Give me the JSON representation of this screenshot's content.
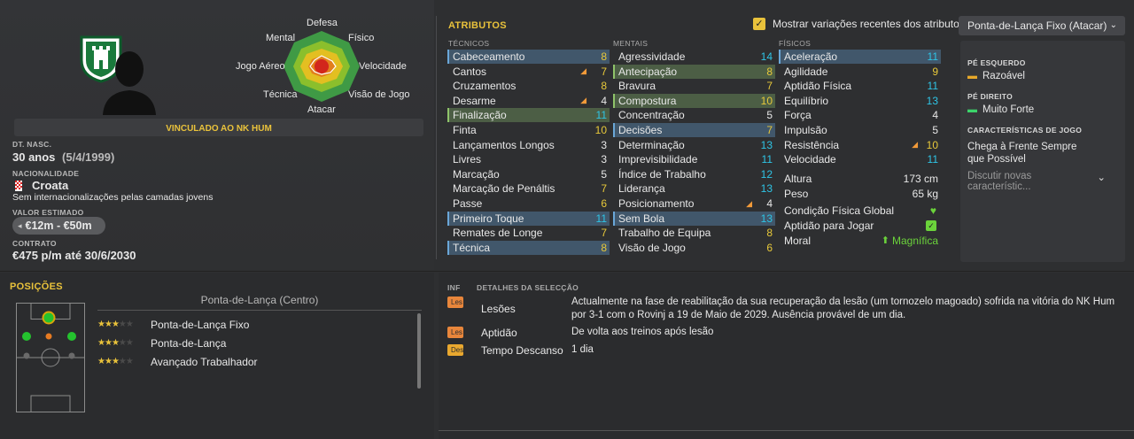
{
  "club_badge": "nk-hum-crest",
  "contract_banner": "VINCULADO AO NK HUM",
  "radar": {
    "labels": {
      "top": "Defesa",
      "tr": "Físico",
      "r": "Velocidade",
      "br": "Visão de Jogo",
      "bottom": "Atacar",
      "bl": "Técnica",
      "l": "Jogo Aéreo",
      "tl": "Mental"
    }
  },
  "bio": {
    "dob_label": "DT. NASC.",
    "age": "30 anos",
    "dob": "(5/4/1999)",
    "nat_label": "NACIONALIDADE",
    "nation": "Croata",
    "intl": "Sem internacionalizações pelas camadas jovens",
    "value_label": "VALOR ESTIMADO",
    "value": "€12m - €50m",
    "contract_label": "CONTRATO",
    "contract": "€475 p/m até 30/6/2030"
  },
  "attrs": {
    "title": "ATRIBUTOS",
    "toggle_label": "Mostrar variações recentes dos atributos",
    "role_select": "Ponta-de-Lança Fixo (Atacar)",
    "tech_header": "TÉCNICOS",
    "mental_header": "MENTAIS",
    "phys_header": "FÍSICOS",
    "technical": [
      {
        "n": "Cabeceamento",
        "v": "8",
        "hl": "blue",
        "c": "c-yel"
      },
      {
        "n": "Cantos",
        "v": "7",
        "up": true,
        "c": "c-yel"
      },
      {
        "n": "Cruzamentos",
        "v": "8",
        "c": "c-yel"
      },
      {
        "n": "Desarme",
        "v": "4",
        "up": true,
        "c": "c-white"
      },
      {
        "n": "Finalização",
        "v": "11",
        "hl": "green",
        "c": "c-cyan"
      },
      {
        "n": "Finta",
        "v": "10",
        "c": "c-yel"
      },
      {
        "n": "Lançamentos Longos",
        "v": "3",
        "c": "c-white"
      },
      {
        "n": "Livres",
        "v": "3",
        "c": "c-white"
      },
      {
        "n": "Marcação",
        "v": "5",
        "c": "c-white"
      },
      {
        "n": "Marcação de Penáltis",
        "v": "7",
        "c": "c-yel"
      },
      {
        "n": "Passe",
        "v": "6",
        "c": "c-yel"
      },
      {
        "n": "Primeiro Toque",
        "v": "11",
        "hl": "blue",
        "c": "c-cyan"
      },
      {
        "n": "Remates de Longe",
        "v": "7",
        "c": "c-yel"
      },
      {
        "n": "Técnica",
        "v": "8",
        "hl": "blue",
        "c": "c-yel"
      }
    ],
    "mental": [
      {
        "n": "Agressividade",
        "v": "14",
        "c": "c-cyan"
      },
      {
        "n": "Antecipação",
        "v": "8",
        "hl": "green",
        "c": "c-yel"
      },
      {
        "n": "Bravura",
        "v": "7",
        "c": "c-yel"
      },
      {
        "n": "Compostura",
        "v": "10",
        "hl": "green",
        "c": "c-yel"
      },
      {
        "n": "Concentração",
        "v": "5",
        "c": "c-white"
      },
      {
        "n": "Decisões",
        "v": "7",
        "hl": "blue",
        "c": "c-yel"
      },
      {
        "n": "Determinação",
        "v": "13",
        "c": "c-cyan"
      },
      {
        "n": "Imprevisibilidade",
        "v": "11",
        "c": "c-cyan"
      },
      {
        "n": "Índice de Trabalho",
        "v": "12",
        "c": "c-cyan"
      },
      {
        "n": "Liderança",
        "v": "13",
        "c": "c-cyan"
      },
      {
        "n": "Posicionamento",
        "v": "4",
        "up": true,
        "c": "c-white"
      },
      {
        "n": "Sem Bola",
        "v": "13",
        "hl": "blue",
        "c": "c-cyan"
      },
      {
        "n": "Trabalho de Equipa",
        "v": "8",
        "c": "c-yel"
      },
      {
        "n": "Visão de Jogo",
        "v": "6",
        "c": "c-yel"
      }
    ],
    "physical": [
      {
        "n": "Aceleração",
        "v": "11",
        "hl": "blue",
        "c": "c-cyan"
      },
      {
        "n": "Agilidade",
        "v": "9",
        "c": "c-yel"
      },
      {
        "n": "Aptidão Física",
        "v": "11",
        "c": "c-cyan"
      },
      {
        "n": "Equilíbrio",
        "v": "13",
        "c": "c-cyan"
      },
      {
        "n": "Força",
        "v": "4",
        "c": "c-white"
      },
      {
        "n": "Impulsão",
        "v": "5",
        "c": "c-white"
      },
      {
        "n": "Resistência",
        "v": "10",
        "up": true,
        "c": "c-yel"
      },
      {
        "n": "Velocidade",
        "v": "11",
        "c": "c-cyan"
      }
    ],
    "extra": {
      "height_label": "Altura",
      "height": "173 cm",
      "weight_label": "Peso",
      "weight": "65 kg",
      "cond_label": "Condição Física Global",
      "match_label": "Aptidão para Jogar",
      "morale_label": "Moral",
      "morale": "Magnífica"
    },
    "feet": {
      "left_label": "PÉ ESQUERDO",
      "left": "Razoável",
      "right_label": "PÉ DIREITO",
      "right": "Muito Forte",
      "traits_label": "CARACTERÍSTICAS DE JOGO",
      "trait": "Chega à Frente Sempre que Possível",
      "discuss": "Discutir novas característic..."
    }
  },
  "positions": {
    "title": "POSIÇÕES",
    "main": "Ponta-de-Lança (Centro)",
    "roles": [
      {
        "name": "Ponta-de-Lança Fixo",
        "stars": 3
      },
      {
        "name": "Ponta-de-Lança",
        "stars": 3
      },
      {
        "name": "Avançado Trabalhador",
        "stars": 2.5
      }
    ]
  },
  "details": {
    "inf": "INF",
    "title": "DETALHES DA SELECÇÃO",
    "rows": [
      {
        "tag": "Les",
        "label": "Lesões",
        "text": "Actualmente na fase de reabilitação da sua recuperação da lesão (um tornozelo magoado) sofrida na vitória do NK Hum por 3-1 com o Rovinj a 19 de Maio de 2029. Ausência provável de um dia."
      },
      {
        "tag": "Les",
        "label": "Aptidão",
        "text": "De volta aos treinos após lesão"
      },
      {
        "tag": "Des",
        "label": "Tempo Descanso",
        "text": "1 dia"
      }
    ]
  }
}
